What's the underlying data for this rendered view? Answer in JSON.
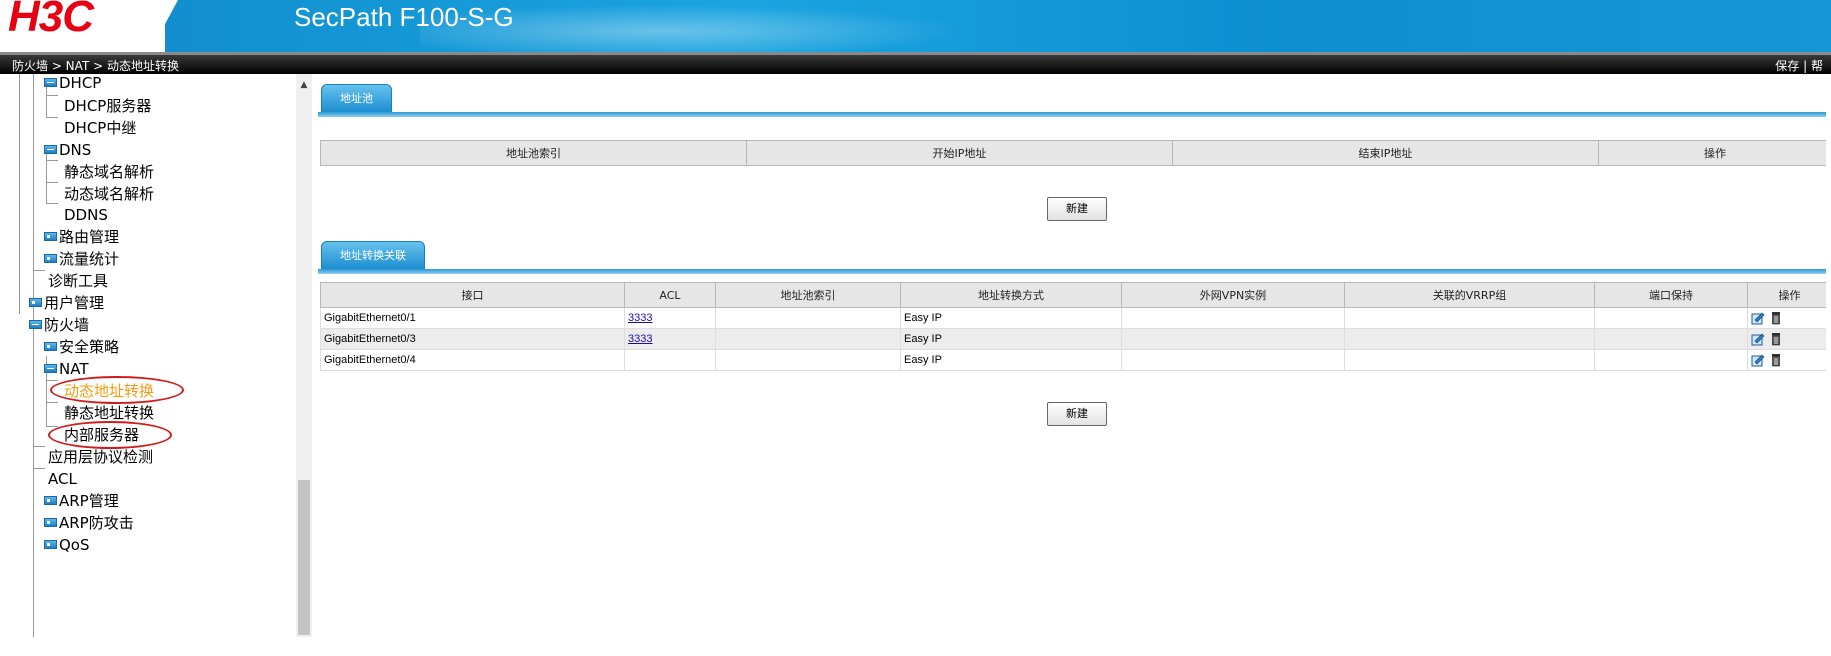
{
  "header": {
    "logo": "H3C",
    "product": "SecPath F100-S-G"
  },
  "breadcrumb": {
    "path": "防火墙 > NAT > 动态地址转换",
    "save_label": "保存",
    "help_label": "| 帮"
  },
  "sidebar": {
    "items": [
      {
        "label": "DHCP",
        "icon": "folder-minus-icon"
      },
      {
        "label": "DHCP服务器"
      },
      {
        "label": "DHCP中继"
      },
      {
        "label": "DNS",
        "icon": "folder-minus-icon"
      },
      {
        "label": "静态域名解析"
      },
      {
        "label": "动态域名解析"
      },
      {
        "label": "DDNS"
      },
      {
        "label": "路由管理",
        "icon": "folder-plus-icon"
      },
      {
        "label": "流量统计",
        "icon": "folder-plus-icon"
      },
      {
        "label": "诊断工具"
      },
      {
        "label": "用户管理",
        "icon": "folder-plus-icon"
      },
      {
        "label": "防火墙",
        "icon": "folder-minus-icon"
      },
      {
        "label": "安全策略",
        "icon": "folder-plus-icon"
      },
      {
        "label": "NAT",
        "icon": "folder-minus-icon"
      },
      {
        "label": "动态地址转换",
        "active": true
      },
      {
        "label": "静态地址转换"
      },
      {
        "label": "内部服务器"
      },
      {
        "label": "应用层协议检测"
      },
      {
        "label": "ACL"
      },
      {
        "label": "ARP管理",
        "icon": "folder-plus-icon"
      },
      {
        "label": "ARP防攻击",
        "icon": "folder-plus-icon"
      },
      {
        "label": "QoS",
        "icon": "folder-plus-icon"
      }
    ]
  },
  "pool_section": {
    "tab_label": "地址池",
    "columns": [
      "地址池索引",
      "开始IP地址",
      "结束IP地址",
      "操作"
    ],
    "new_button": "新建"
  },
  "nat_section": {
    "tab_label": "地址转换关联",
    "columns": [
      "接口",
      "ACL",
      "地址池索引",
      "地址转换方式",
      "外网VPN实例",
      "关联的VRRP组",
      "端口保持",
      "操作"
    ],
    "rows": [
      {
        "interface": "GigabitEthernet0/1",
        "acl": "3333",
        "pool": "",
        "mode": "Easy IP",
        "vpn": "",
        "vrrp": "",
        "port": ""
      },
      {
        "interface": "GigabitEthernet0/3",
        "acl": "3333",
        "pool": "",
        "mode": "Easy IP",
        "vpn": "",
        "vrrp": "",
        "port": ""
      },
      {
        "interface": "GigabitEthernet0/4",
        "acl": "",
        "pool": "",
        "mode": "Easy IP",
        "vpn": "",
        "vrrp": "",
        "port": ""
      }
    ],
    "new_button": "新建"
  },
  "colors": {
    "header_blue": "#1aa4e0",
    "logo_red": "#e60012",
    "active_item": "#f39c12",
    "annotation_red": "#d11a1a"
  }
}
